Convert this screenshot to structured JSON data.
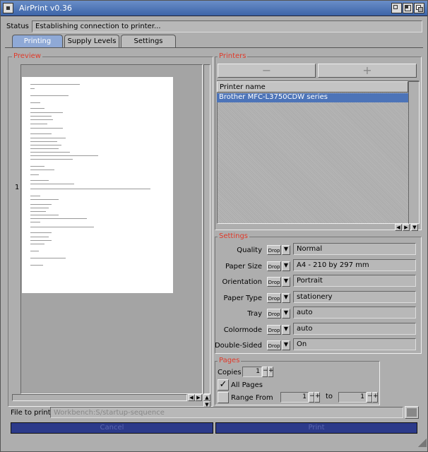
{
  "window": {
    "title": "AirPrint v0.36"
  },
  "status": {
    "label": "Status",
    "value": "Establishing connection to printer..."
  },
  "tabs": [
    {
      "label": "Printing"
    },
    {
      "label": "Supply Levels"
    },
    {
      "label": "Settings"
    }
  ],
  "preview": {
    "title": "Preview",
    "page_number": "1"
  },
  "printers": {
    "title": "Printers",
    "remove_label": "−",
    "add_label": "+",
    "column_header": "Printer name",
    "items": [
      "Brother MFC-L3750CDW series"
    ]
  },
  "settings": {
    "title": "Settings",
    "drop_label": "Drop",
    "rows": [
      {
        "label": "Quality",
        "value": "Normal"
      },
      {
        "label": "Paper Size",
        "value": "A4 - 210 by 297 mm"
      },
      {
        "label": "Orientation",
        "value": "Portrait"
      },
      {
        "label": "Paper Type",
        "value": "stationery"
      },
      {
        "label": "Tray",
        "value": "auto"
      },
      {
        "label": "Colormode",
        "value": "auto"
      },
      {
        "label": "Double-Sided",
        "value": "On"
      }
    ]
  },
  "pages": {
    "title": "Pages",
    "copies_label": "Copies",
    "copies_value": "1",
    "all_pages_label": "All Pages",
    "all_pages_checked": true,
    "range_label": "Range From",
    "range_from": "1",
    "to_label": "to",
    "range_to": "1"
  },
  "file": {
    "label": "File to print",
    "value": "Workbench:S/startup-sequence"
  },
  "actions": {
    "cancel": "Cancel",
    "print": "Print"
  },
  "colors": {
    "accent": "#e03a2a",
    "selection": "#4d74b8",
    "action_bar": "#2c3a8a"
  }
}
